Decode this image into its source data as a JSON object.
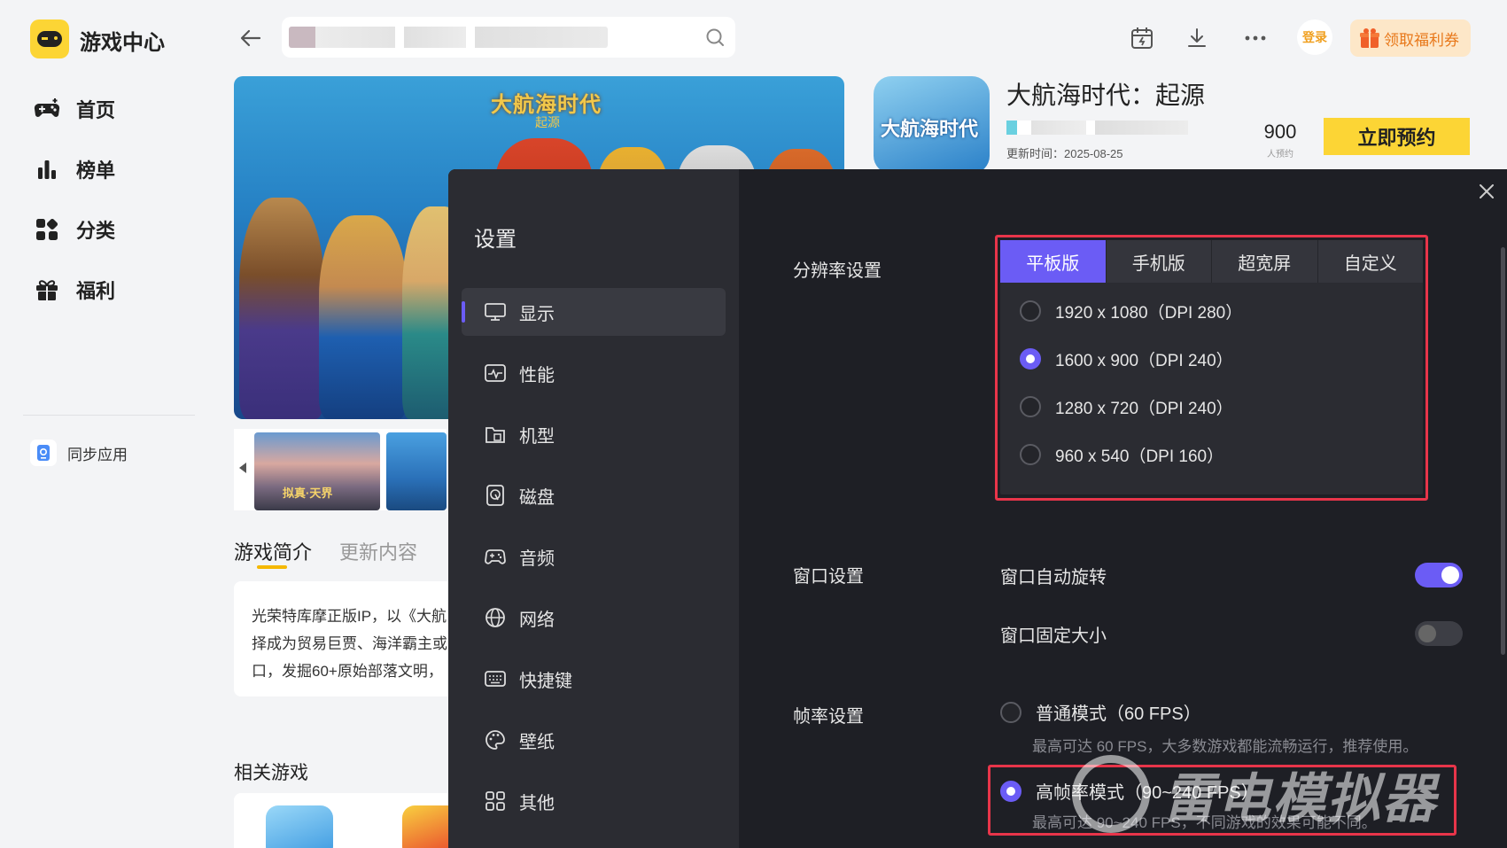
{
  "app": {
    "title": "游戏中心",
    "nav": [
      {
        "label": "首页",
        "icon": "gamepad-icon"
      },
      {
        "label": "榜单",
        "icon": "bar-chart-icon"
      },
      {
        "label": "分类",
        "icon": "grid-icon"
      },
      {
        "label": "福利",
        "icon": "gift-icon"
      }
    ],
    "sync_label": "同步应用",
    "login_label": "登录",
    "coupon_label": "领取福利券"
  },
  "game": {
    "name": "大航海时代：起源",
    "updated": "更新时间：2025-08-25",
    "reserve_count": "900",
    "reserve_unit": "人预约",
    "reserve_button": "立即预约",
    "banner_title": "大航海时代",
    "banner_subtitle": "起源",
    "icon_text": "大航海时代",
    "thumb_label": "拟真·天界"
  },
  "detail": {
    "tabs": [
      "游戏简介",
      "更新内容"
    ],
    "intro_lines": [
      "光荣特库摩正版IP，以《大航",
      "择成为贸易巨贾、海洋霸主或",
      "口，发掘60+原始部落文明，"
    ],
    "related_title": "相关游戏"
  },
  "settings": {
    "title": "设置",
    "nav": [
      {
        "label": "显示",
        "icon": "monitor-icon",
        "active": true
      },
      {
        "label": "性能",
        "icon": "performance-icon",
        "active": false
      },
      {
        "label": "机型",
        "icon": "folder-icon",
        "active": false
      },
      {
        "label": "磁盘",
        "icon": "disk-icon",
        "active": false
      },
      {
        "label": "音频",
        "icon": "gamepad-icon",
        "active": false
      },
      {
        "label": "网络",
        "icon": "globe-icon",
        "active": false
      },
      {
        "label": "快捷键",
        "icon": "keyboard-icon",
        "active": false
      },
      {
        "label": "壁纸",
        "icon": "palette-icon",
        "active": false
      },
      {
        "label": "其他",
        "icon": "apps-icon",
        "active": false
      }
    ],
    "resolution": {
      "label": "分辨率设置",
      "tabs": [
        "平板版",
        "手机版",
        "超宽屏",
        "自定义"
      ],
      "active_tab": "平板版",
      "options": [
        {
          "label": "1920 x 1080（DPI 280）",
          "selected": false
        },
        {
          "label": "1600 x 900（DPI 240）",
          "selected": true
        },
        {
          "label": "1280 x 720（DPI 240）",
          "selected": false
        },
        {
          "label": "960 x 540（DPI 160）",
          "selected": false
        }
      ]
    },
    "window": {
      "label": "窗口设置",
      "auto_rotate": {
        "label": "窗口自动旋转",
        "on": true
      },
      "fixed_size": {
        "label": "窗口固定大小",
        "on": false
      }
    },
    "fps": {
      "label": "帧率设置",
      "normal": {
        "label": "普通模式（60 FPS）",
        "desc": "最高可达 60 FPS，大多数游戏都能流畅运行，推荐使用。",
        "selected": false
      },
      "high": {
        "label": "高帧率模式（90~240 FPS）",
        "desc": "最高可达 90~240 FPS，不同游戏的效果可能不同。",
        "selected": true
      }
    }
  },
  "watermark": "雷电模拟器",
  "colors": {
    "accent": "#6b5cf5",
    "highlight_border": "#e8354a",
    "brand_yellow": "#fcd535"
  }
}
